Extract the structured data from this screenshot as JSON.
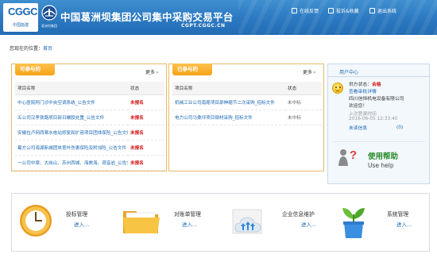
{
  "header": {
    "logo_mark": "CGGC",
    "logo_sub": "中国能建",
    "logo2_sub": "葛洲坝集团",
    "title": "中国葛洲坝集团公司集中采购交易平台",
    "url": "CGPT.CGGC.CN",
    "links": [
      {
        "label": "在线反馈",
        "icon": "edit-icon"
      },
      {
        "label": "投诉&收藏",
        "icon": "complaint-icon"
      },
      {
        "label": "退出系统",
        "icon": "logout-icon"
      }
    ]
  },
  "breadcrumb": {
    "prefix": "您现在的位置：",
    "home": "首页"
  },
  "panel_joinable": {
    "tab": "可参与的",
    "more": "更多",
    "col_project": "项目名称",
    "col_status": "状态",
    "rows": [
      {
        "project": "中心医院阿门诊中央空调系统_公告文件",
        "status": "未报名"
      },
      {
        "project": "五公司汉孝铁路项目部日螺胶处置_公告文件",
        "status": "未报名"
      },
      {
        "project": "安徽拉卢网西寒水电站修复和扩容项目团体保险_公告文件",
        "status": "未报名"
      },
      {
        "project": "葛方公司海湖新城团体意外伤害保险及附加险_公告文件",
        "status": "未报名"
      },
      {
        "project": "一公司中梁、大岗山、苏州西城、海救海、观音岩_公告文件",
        "status": "未报名"
      }
    ]
  },
  "panel_joined": {
    "tab": "已参与的",
    "more": "更多",
    "col_project": "项目名称",
    "col_status": "状态",
    "rows": [
      {
        "project": "机械工业公司南尾项目部伸缩节二次采购_招标文件",
        "status": "未中标"
      },
      {
        "project": "电力公司马桑坪项目钢材采购_招标文件",
        "status": "未中标"
      }
    ]
  },
  "user_center": {
    "title": "用户中心",
    "status_label": "供方状态：",
    "status_value": "合格",
    "review_link": "查看审批详情",
    "company": "四川信恒机电设备有限公司",
    "welcome": "欢迎您！",
    "last_login_label": "上次登录时间",
    "last_login_time": "2016-06-05 12:33:40",
    "unread_label": "未读信息",
    "unread_count": "(0)",
    "help_title": "使用帮助",
    "help_sub": "Use help"
  },
  "quick_links": [
    {
      "label": "投标管理",
      "enter": "进入...",
      "icon": "clock-icon"
    },
    {
      "label": "对账单管理",
      "enter": "进入...",
      "icon": "folder-icon"
    },
    {
      "label": "企业信息维护",
      "enter": "进入...",
      "icon": "cloud-upload-icon"
    },
    {
      "label": "系统管理",
      "enter": "进入...",
      "icon": "plant-pot-icon"
    }
  ],
  "colors": {
    "header_blue": "#2e7cc4",
    "tab_orange": "#f4a418",
    "status_red": "#d01010",
    "link_blue": "#1a67b3",
    "help_green": "#2a8a2a"
  }
}
